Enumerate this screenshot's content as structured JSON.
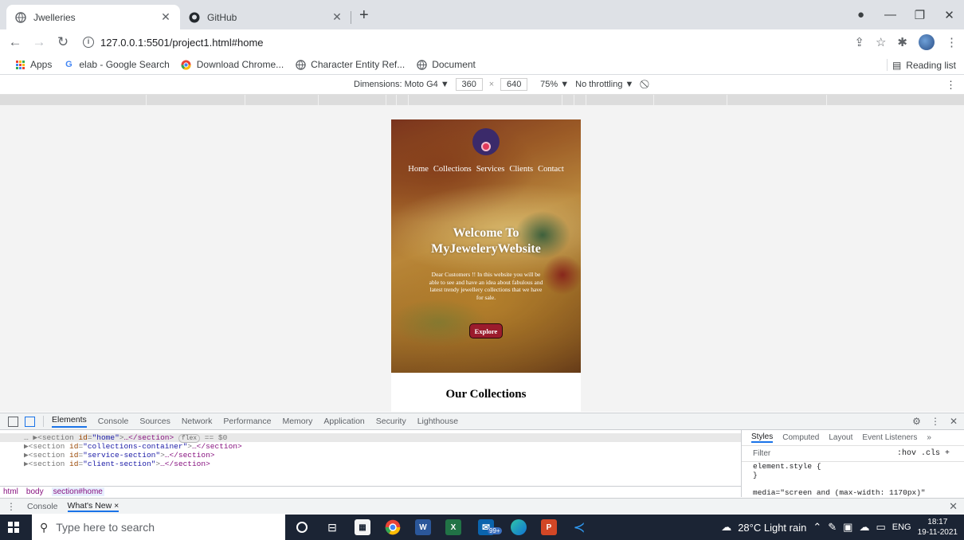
{
  "browser": {
    "tabs": [
      {
        "title": "Jwelleries",
        "icon": "globe-icon"
      },
      {
        "title": "GitHub",
        "icon": "github-icon"
      }
    ],
    "new_tab": "+",
    "url": "127.0.0.1:5501/project1.html#home",
    "bookmarks": [
      {
        "label": "Apps",
        "icon": "apps-grid-icon"
      },
      {
        "label": "elab - Google Search",
        "icon": "google-icon"
      },
      {
        "label": "Download Chrome...",
        "icon": "chrome-icon"
      },
      {
        "label": "Character Entity Ref...",
        "icon": "globe-icon"
      },
      {
        "label": "Document",
        "icon": "globe-icon"
      }
    ],
    "reading_list": "Reading list"
  },
  "device_toolbar": {
    "dimensions_label": "Dimensions: Moto G4 ▼",
    "width": "360",
    "times": "×",
    "height": "640",
    "zoom": "75% ▼",
    "throttling": "No throttling ▼"
  },
  "site": {
    "nav": [
      "Home",
      "Collections",
      "Services",
      "Clients",
      "Contact"
    ],
    "welcome_line1": "Welcome To",
    "welcome_line2": "MyJeweleryWebsite",
    "description": "Dear Customers !! In this website you will be able to see and have an idea about fabulous and latest trendy jewellery collections that we have for sale.",
    "explore_button": "Explore",
    "collections_heading": "Our Collections"
  },
  "devtools": {
    "tabs": [
      "Elements",
      "Console",
      "Sources",
      "Network",
      "Performance",
      "Memory",
      "Application",
      "Security",
      "Lighthouse"
    ],
    "selected_tab": "Elements",
    "dom_lines": [
      {
        "id": "home",
        "tail": "…</section>",
        "badge": "flex",
        "extra": "== $0",
        "selected": true
      },
      {
        "id": "collections-container",
        "tail": "…</section>",
        "badge": "",
        "extra": "",
        "selected": false
      },
      {
        "id": "service-section",
        "tail": "…</section>",
        "badge": "",
        "extra": "",
        "selected": false
      },
      {
        "id": "client-section",
        "tail": "…</section>",
        "badge": "",
        "extra": "",
        "selected": false
      }
    ],
    "breadcrumbs": [
      "html",
      "body",
      "section#home"
    ],
    "styles_tabs": [
      "Styles",
      "Computed",
      "Layout",
      "Event Listeners",
      "»"
    ],
    "filter_placeholder": "Filter",
    "filter_tools": ":hov  .cls  +",
    "element_style": "element.style {",
    "element_style_close": "}",
    "media_rule": "media=\"screen and (max-width: 1170px)\"",
    "drawer_tabs": [
      "Console",
      "What's New ×"
    ]
  },
  "taskbar": {
    "search_placeholder": "Type here to search",
    "weather": "28°C  Light rain",
    "language": "ENG",
    "time": "18:17",
    "date": "19-11-2021",
    "mail_badge": "99+"
  }
}
